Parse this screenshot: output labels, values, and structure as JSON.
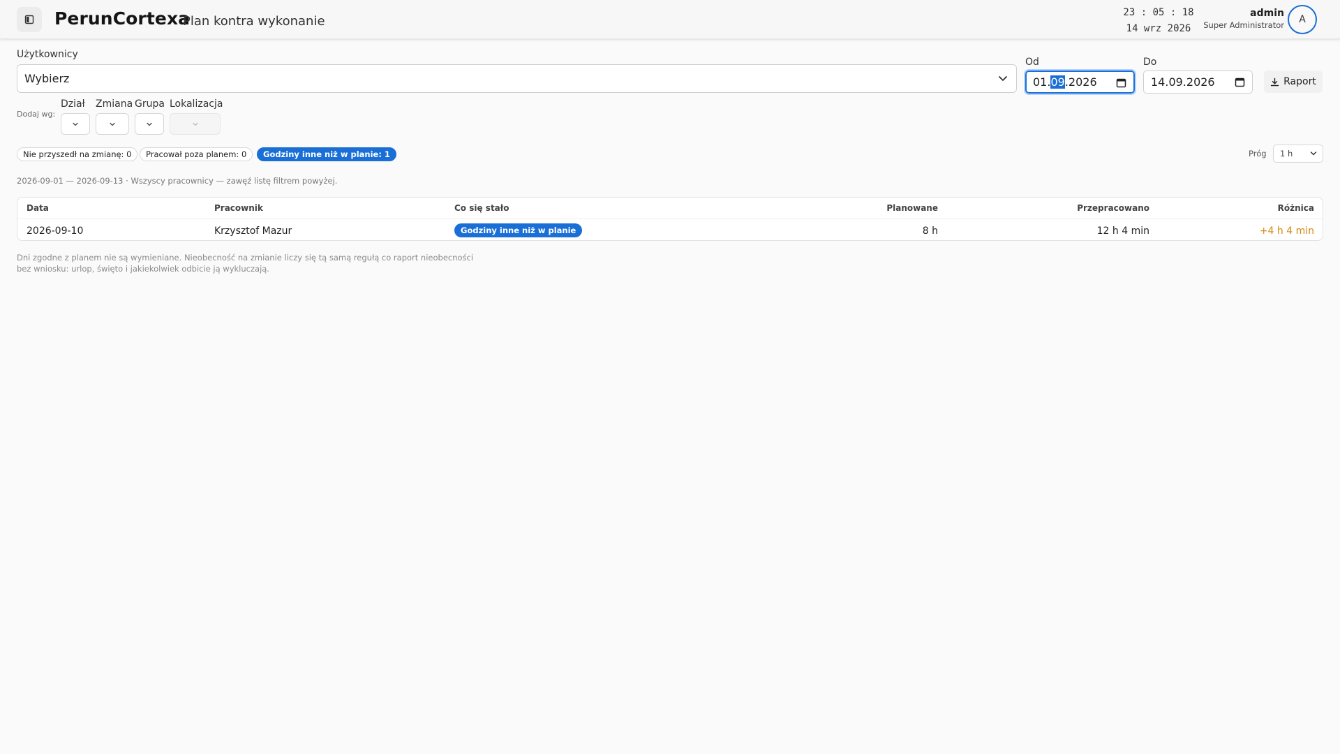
{
  "header": {
    "app_name": "PerunCortexa",
    "page_title": "Plan kontra wykonanie",
    "clock_time": "23 : 05 : 18",
    "clock_date": "14 wrz 2026",
    "user_name": "admin",
    "user_role": "Super Administrator",
    "avatar_initial": "A"
  },
  "filters": {
    "users_label": "Użytkownicy",
    "users_value": "Wybierz",
    "from_label": "Od",
    "from_day": "01.",
    "from_month_selected": "09",
    "from_year": ".2026",
    "to_label": "Do",
    "to_value": "14.09.2026",
    "report_button": "Raport",
    "add_by_label": "Dodaj wg:",
    "dept_label": "Dział",
    "shift_label": "Zmiana",
    "group_label": "Grupa",
    "location_label": "Lokalizacja"
  },
  "chips": [
    {
      "label": "Nie przyszedł na zmianę: 0",
      "active": false
    },
    {
      "label": "Pracował poza planem: 0",
      "active": false
    },
    {
      "label": "Godziny inne niż w planie: 1",
      "active": true
    }
  ],
  "threshold": {
    "label": "Próg",
    "value": "1 h"
  },
  "summary": "2026-09-01 — 2026-09-13 · Wszyscy pracownicy — zawęź listę filtrem powyżej.",
  "table": {
    "headers": {
      "date": "Data",
      "employee": "Pracownik",
      "what": "Co się stało",
      "planned": "Planowane",
      "worked": "Przepracowano",
      "difference": "Różnica"
    },
    "rows": [
      {
        "date": "2026-09-10",
        "employee": "Krzysztof Mazur",
        "what": "Godziny inne niż w planie",
        "planned": "8 h",
        "worked": "12 h 4 min",
        "difference": "+4 h 4 min"
      }
    ]
  },
  "footnote": "Dni zgodne z planem nie są wymieniane. Nieobecność na zmianie liczy się tą samą regułą co raport nieobecności bez wniosku: urlop, święto i jakiekolwiek odbicie ją wykluczają.",
  "colors": {
    "accent": "#1a6fd6",
    "diff": "#d08a13"
  }
}
